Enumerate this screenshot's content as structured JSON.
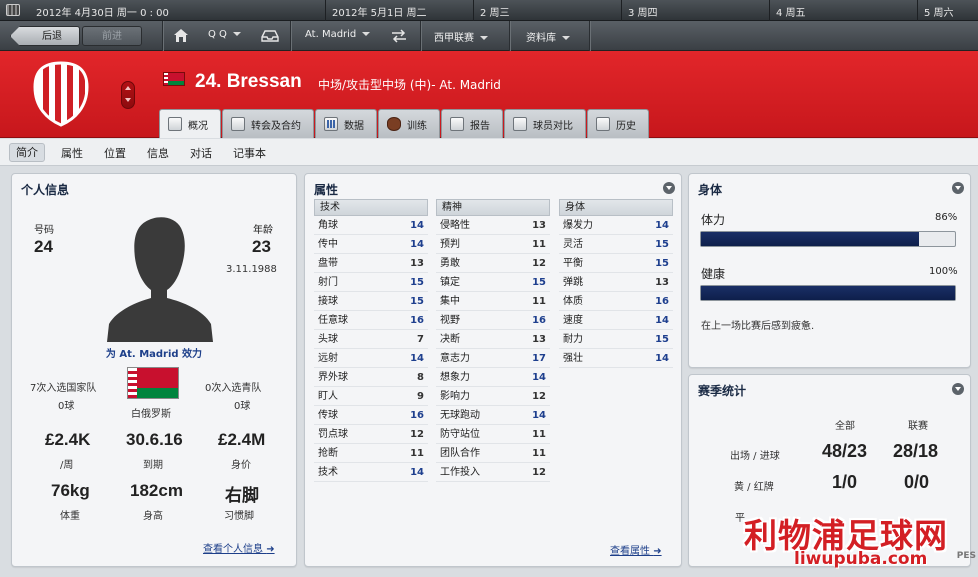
{
  "calendar": {
    "today": "2012年 4月30日    周一    0 : 00",
    "days": [
      "2012年 5月1日    周二",
      "2 周三",
      "3 周四",
      "4 周五",
      "5 周六"
    ]
  },
  "nav": {
    "back": "后退",
    "forward": "前进",
    "user": "Q Q",
    "club": "At. Madrid",
    "league": "西甲联赛",
    "database": "资料库"
  },
  "player": {
    "name": "24. Bressan",
    "role": "中场/攻击型中场 (中)- At. Madrid"
  },
  "tabs": [
    "概况",
    "转会及合约",
    "数据",
    "训练",
    "报告",
    "球员对比",
    "历史"
  ],
  "subtabs": [
    "简介",
    "属性",
    "位置",
    "信息",
    "对话",
    "记事本"
  ],
  "personal": {
    "title": "个人信息",
    "number_label": "号码",
    "number": "24",
    "age_label": "年龄",
    "age": "23",
    "dob": "3.11.1988",
    "club_link": "为 At. Madrid 效力",
    "national_caps": "7次入选国家队",
    "national_goals": "0球",
    "youth_caps": "0次入选青队",
    "youth_goals": "0球",
    "nation": "白俄罗斯",
    "wage": "£2.4K",
    "wage_label": "/周",
    "expiry": "30.6.16",
    "expiry_label": "到期",
    "value": "£2.4M",
    "value_label": "身价",
    "weight": "76kg",
    "weight_label": "体重",
    "height": "182cm",
    "height_label": "身高",
    "foot": "右脚",
    "foot_label": "习惯脚",
    "more_link": "查看个人信息"
  },
  "attributes": {
    "title": "属性",
    "more_link": "查看属性",
    "technical": {
      "header": "技术",
      "rows": [
        [
          "角球",
          "14"
        ],
        [
          "传中",
          "14"
        ],
        [
          "盘带",
          "13"
        ],
        [
          "射门",
          "15"
        ],
        [
          "接球",
          "15"
        ],
        [
          "任意球",
          "16"
        ],
        [
          "头球",
          "7"
        ],
        [
          "远射",
          "14"
        ],
        [
          "界外球",
          "8"
        ],
        [
          "盯人",
          "9"
        ],
        [
          "传球",
          "16"
        ],
        [
          "罚点球",
          "12"
        ],
        [
          "抢断",
          "11"
        ],
        [
          "技术",
          "14"
        ]
      ]
    },
    "mental": {
      "header": "精神",
      "rows": [
        [
          "侵略性",
          "13"
        ],
        [
          "预判",
          "11"
        ],
        [
          "勇敢",
          "12"
        ],
        [
          "镇定",
          "15"
        ],
        [
          "集中",
          "11"
        ],
        [
          "视野",
          "16"
        ],
        [
          "决断",
          "13"
        ],
        [
          "意志力",
          "17"
        ],
        [
          "想象力",
          "14"
        ],
        [
          "影响力",
          "12"
        ],
        [
          "无球跑动",
          "14"
        ],
        [
          "防守站位",
          "11"
        ],
        [
          "团队合作",
          "11"
        ],
        [
          "工作投入",
          "12"
        ]
      ]
    },
    "physical": {
      "header": "身体",
      "rows": [
        [
          "爆发力",
          "14"
        ],
        [
          "灵活",
          "15"
        ],
        [
          "平衡",
          "15"
        ],
        [
          "弹跳",
          "13"
        ],
        [
          "体质",
          "16"
        ],
        [
          "速度",
          "14"
        ],
        [
          "耐力",
          "15"
        ],
        [
          "强壮",
          "14"
        ]
      ]
    }
  },
  "fitness": {
    "title": "身体",
    "condition_label": "体力",
    "condition_value": "86%",
    "condition_fraction": 0.86,
    "health_label": "健康",
    "health_value": "100%",
    "health_fraction": 1.0,
    "note": "在上一场比赛后感到疲惫."
  },
  "season": {
    "title": "赛季统计",
    "col_all": "全部",
    "col_league": "联赛",
    "apps_label": "出场 / 进球",
    "apps_all": "48/23",
    "apps_league": "28/18",
    "cards_label": "黄 / 红牌",
    "cards_all": "1/0",
    "cards_league": "0/0",
    "partial_label": "平"
  },
  "watermark": {
    "line1": "利物浦足球网",
    "line2": "liwupuba.com",
    "corner": "PES"
  },
  "colors": {
    "header_red": "#d91f24",
    "link_blue": "#1d3f8a",
    "bar_navy": "#132659"
  }
}
